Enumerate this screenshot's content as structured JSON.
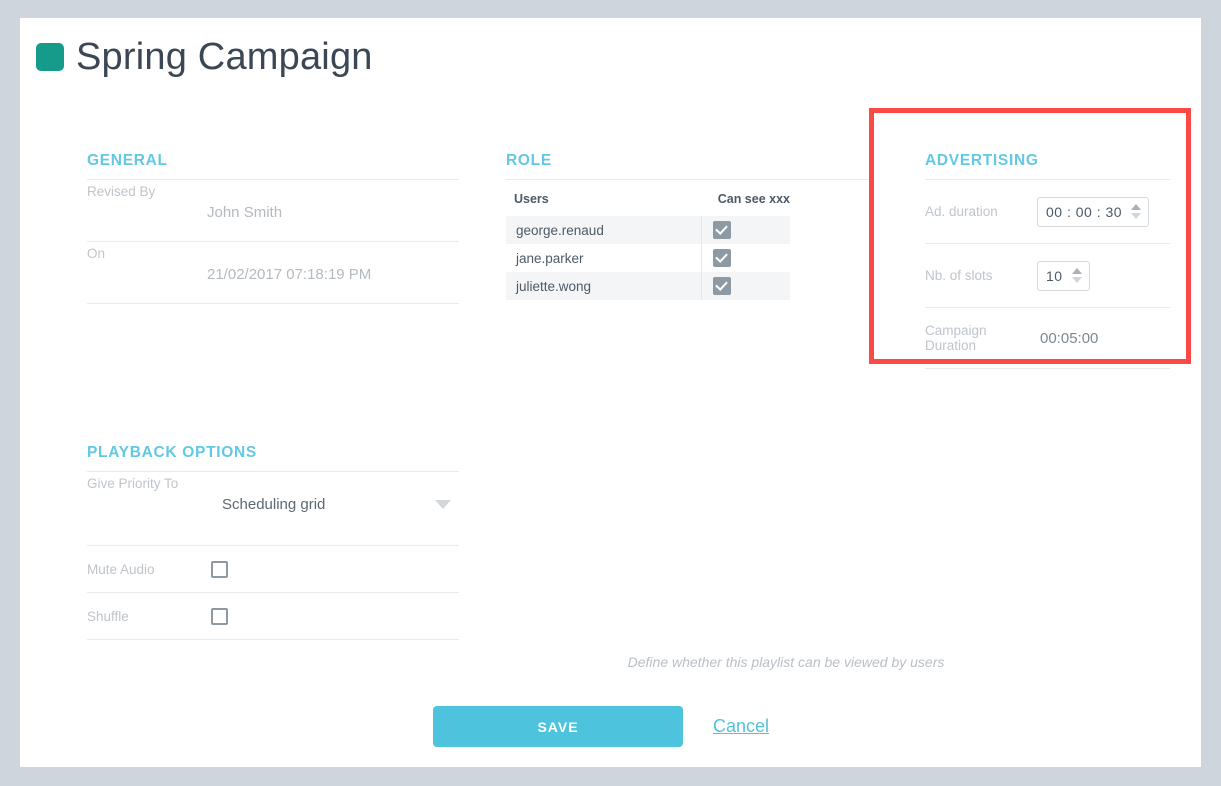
{
  "header": {
    "title": "Spring Campaign",
    "swatch_color": "#169b8a"
  },
  "general": {
    "section_title": "GENERAL",
    "rows": [
      {
        "label": "Revised By",
        "value": "John Smith"
      },
      {
        "label": "On",
        "value": "21/02/2017 07:18:19 PM"
      }
    ]
  },
  "playback": {
    "section_title": "PLAYBACK OPTIONS",
    "priority": {
      "label": "Give Priority To",
      "value": "Scheduling grid"
    },
    "mute_audio": {
      "label": "Mute Audio",
      "checked": false
    },
    "shuffle": {
      "label": "Shuffle",
      "checked": false
    }
  },
  "role": {
    "section_title": "ROLE",
    "columns": [
      "Users",
      "Can see xxx"
    ],
    "rows": [
      {
        "user": "george.renaud",
        "can_see": true
      },
      {
        "user": "jane.parker",
        "can_see": true
      },
      {
        "user": "juliette.wong",
        "can_see": true
      }
    ]
  },
  "advertising": {
    "section_title": "ADVERTISING",
    "highlight_color": "#f94a45",
    "ad_duration": {
      "label": "Ad. duration",
      "value": "00 : 00 : 30"
    },
    "nb_of_slots": {
      "label": "Nb. of slots",
      "value": "10"
    },
    "campaign_duration": {
      "label": "Campaign Duration",
      "value": "00:05:00"
    }
  },
  "footer": {
    "hint": "Define whether this playlist can be viewed by users",
    "save_label": "SAVE",
    "cancel_label": "Cancel",
    "save_color": "#4ec3de"
  }
}
